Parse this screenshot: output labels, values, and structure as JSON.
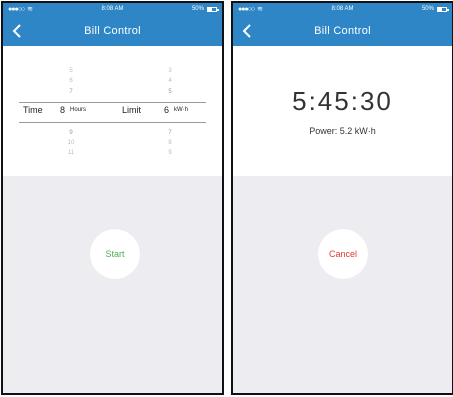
{
  "colors": {
    "header_bg": "#2f86c7",
    "header_text": "#ffffff",
    "content_bg": "#ececf1",
    "start_text": "#4caf50",
    "cancel_text": "#e53935"
  },
  "status_bar": {
    "signal_dots": "●●●○○",
    "time": "8:08 AM",
    "battery": "50%",
    "battery_fraction": 0.5
  },
  "left_screen": {
    "title": "Bill Control",
    "picker": {
      "time_label": "Time",
      "time_value": "8",
      "time_unit": "Hours",
      "limit_label": "Limit",
      "limit_value": "6",
      "limit_unit": "kW·h",
      "time_above": [
        "5",
        "6",
        "7"
      ],
      "time_below": [
        "9",
        "10",
        "11"
      ],
      "limit_above": [
        "3",
        "4",
        "5"
      ],
      "limit_below": [
        "7",
        "8",
        "9"
      ]
    },
    "start_label": "Start"
  },
  "right_screen": {
    "title": "Bill Control",
    "timer": "5:45:30",
    "power_text": "Power: 5.2 kW·h",
    "cancel_label": "Cancel"
  }
}
